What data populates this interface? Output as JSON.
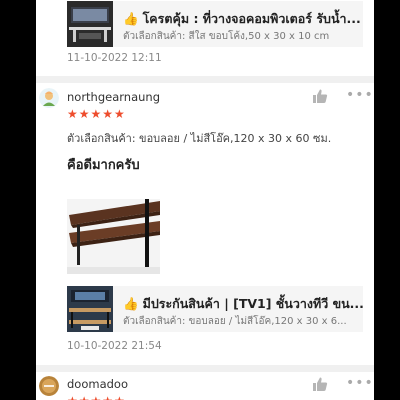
{
  "top_product": {
    "title": "โครตคุ้ม : ที่วางจอคอมพิวเตอร์ รับน้ำ...",
    "variant": "ตัวเลือกสินค้า: สีใส ขอบโค้ง,50 x 30 x 10 cm"
  },
  "top_review_date": "11-10-2022 12:11",
  "reviews": [
    {
      "username": "northgearnaung",
      "stars": "★★★★★",
      "option": "ตัวเลือกสินค้า: ขอบลอย / ไม่สีโอ๊ค,120 x 30 x 60 ซม.",
      "comment": "คือดีมากครับ",
      "product_title": "มีประกันสินค้า | [TV1] ชั้นวางทีวี ขน...",
      "product_variant": "ตัวเลือกสินค้า: ขอบลอย / ไม่สีโอ๊ค,120 x 30 x 6...",
      "date": "10-10-2022 21:54"
    },
    {
      "username": "doomadoo",
      "stars": "★★★★★"
    }
  ],
  "icons": {
    "thumbs_emoji": "👍",
    "more": "•••",
    "like": "thumbs-up-icon"
  },
  "colors": {
    "star": "#ee4d2d",
    "emoji": "#f2a900",
    "card_bg": "#f5f5f5"
  }
}
